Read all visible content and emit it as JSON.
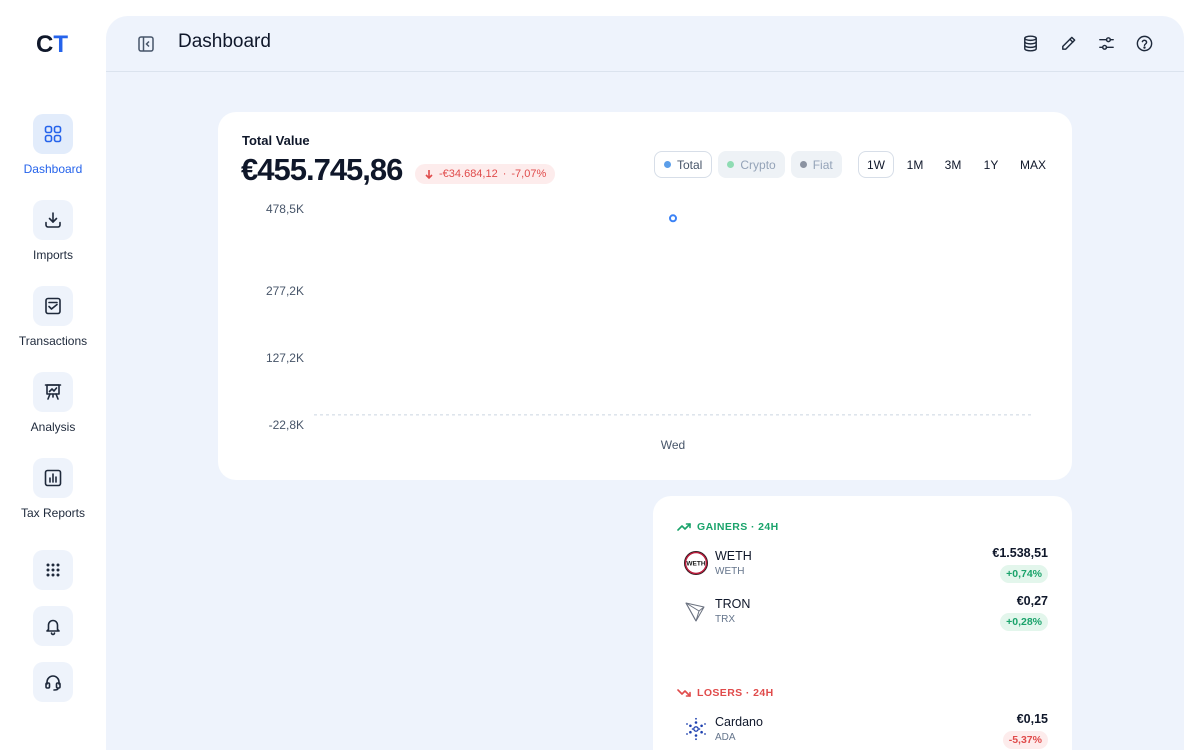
{
  "app": {
    "logo_c": "C",
    "logo_t": "T"
  },
  "sidebar": {
    "items": [
      {
        "label": "Dashboard",
        "icon": "grid-icon",
        "active": true
      },
      {
        "label": "Imports",
        "icon": "download-icon"
      },
      {
        "label": "Transactions",
        "icon": "transactions-icon"
      },
      {
        "label": "Analysis",
        "icon": "presentation-chart-icon"
      },
      {
        "label": "Tax Reports",
        "icon": "bar-chart-icon"
      }
    ],
    "bottom_icons": [
      "apps-grid-icon",
      "bell-icon",
      "headset-icon"
    ]
  },
  "header": {
    "title": "Dashboard",
    "actions": [
      "database-icon",
      "pencil-icon",
      "sliders-icon",
      "help-icon"
    ]
  },
  "portfolio": {
    "label": "Total Value",
    "value": "€455.745,86",
    "change_amount": "-€34.684,12",
    "change_sep": "·",
    "change_pct": "-7,07%",
    "legend": [
      {
        "label": "Total",
        "color": "#5b9ee9",
        "active": true
      },
      {
        "label": "Crypto",
        "color": "#8fdcb3",
        "active": false
      },
      {
        "label": "Fiat",
        "color": "#8b93a1",
        "active": false
      }
    ],
    "ranges": [
      {
        "label": "1W",
        "active": true
      },
      {
        "label": "1M"
      },
      {
        "label": "3M"
      },
      {
        "label": "1Y"
      },
      {
        "label": "MAX"
      }
    ]
  },
  "chart_data": {
    "type": "line",
    "title": "Total Value",
    "x_categories": [
      "Wed"
    ],
    "y_ticks": [
      "478,5K",
      "277,2K",
      "127,2K",
      "-22,8K"
    ],
    "y_tick_values": [
      478500,
      277200,
      127200,
      -22800
    ],
    "ylim": [
      -22800,
      478500
    ],
    "series": [
      {
        "name": "Total",
        "color": "#3b82f6",
        "points": [
          {
            "x": "Wed",
            "y": 455745.86
          }
        ]
      }
    ],
    "zero_line": true,
    "grid": false
  },
  "gainers": {
    "title": "GAINERS · 24H",
    "items": [
      {
        "name": "WETH",
        "symbol": "WETH",
        "price": "€1.538,51",
        "pct": "+0,74%",
        "logo_text": "WETH"
      },
      {
        "name": "TRON",
        "symbol": "TRX",
        "price": "€0,27",
        "pct": "+0,28%"
      }
    ]
  },
  "losers": {
    "title": "LOSERS · 24H",
    "items": [
      {
        "name": "Cardano",
        "symbol": "ADA",
        "price": "€0,15",
        "pct": "-5,37%"
      }
    ]
  }
}
